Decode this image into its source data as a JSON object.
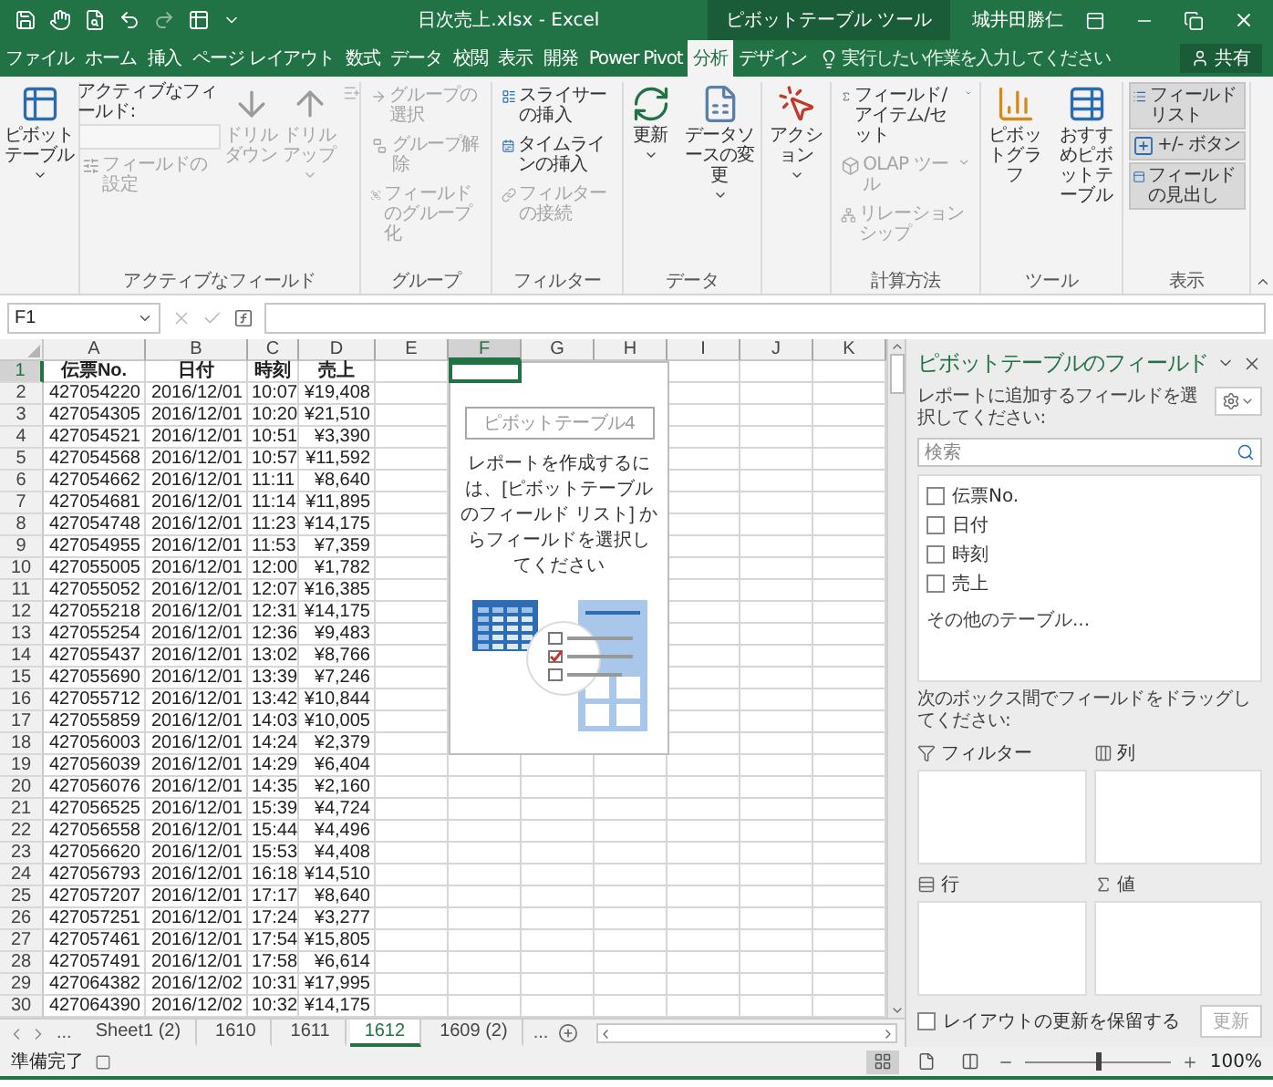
{
  "title_bar": {
    "title": "日次売上.xlsx - Excel",
    "context_tab": "ピボットテーブル ツール",
    "user": "城井田勝仁"
  },
  "tabs": [
    {
      "label": "ファイル",
      "selected": false
    },
    {
      "label": "ホーム",
      "selected": false
    },
    {
      "label": "挿入",
      "selected": false
    },
    {
      "label": "ページ レイアウト",
      "selected": false
    },
    {
      "label": "数式",
      "selected": false
    },
    {
      "label": "データ",
      "selected": false
    },
    {
      "label": "校閲",
      "selected": false
    },
    {
      "label": "表示",
      "selected": false
    },
    {
      "label": "開発",
      "selected": false
    },
    {
      "label": "Power Pivot",
      "selected": false
    },
    {
      "label": "分析",
      "selected": true
    },
    {
      "label": "デザイン",
      "selected": false
    }
  ],
  "tell_me": {
    "placeholder": "実行したい作業を入力してください"
  },
  "share": "共有",
  "ribbon": [
    {
      "items": [
        {
          "kind": "large",
          "label": "ピボットテーブル",
          "disabled": false
        }
      ]
    },
    {
      "label": "アクティブなフィールド",
      "items": [
        {
          "kind": "stack",
          "items": [
            {
              "kind": "field",
              "caption": "アクティブなフィールド:",
              "disabled": true
            },
            {
              "kind": "small",
              "label": "フィールドの設定",
              "disabled": true
            }
          ]
        },
        {
          "kind": "large",
          "label": "ドリルダウン",
          "disabled": true
        },
        {
          "kind": "large",
          "label": "ドリルアップ",
          "disabled": true
        },
        {
          "kind": "icon",
          "disabled": true
        }
      ]
    },
    {
      "label": "グループ",
      "items": [
        {
          "kind": "stack",
          "items": [
            {
              "kind": "small",
              "label": "グループの選択",
              "disabled": true
            },
            {
              "kind": "small",
              "label": "グループ解除",
              "disabled": true
            },
            {
              "kind": "small",
              "label": "フィールドのグループ化",
              "disabled": true
            }
          ]
        }
      ]
    },
    {
      "label": "フィルター",
      "items": [
        {
          "kind": "stack",
          "items": [
            {
              "kind": "small",
              "label": "スライサーの挿入",
              "disabled": false
            },
            {
              "kind": "small",
              "label": "タイムラインの挿入",
              "disabled": false
            },
            {
              "kind": "small",
              "label": "フィルターの接続",
              "disabled": true
            }
          ]
        }
      ]
    },
    {
      "label": "データ",
      "items": [
        {
          "kind": "large",
          "label": "更新",
          "disabled": false
        },
        {
          "kind": "large",
          "label": "データソースの変更",
          "disabled": false
        }
      ]
    },
    {
      "items": [
        {
          "kind": "large",
          "label": "アクション",
          "disabled": false
        }
      ]
    },
    {
      "label": "計算方法",
      "items": [
        {
          "kind": "stack",
          "items": [
            {
              "kind": "small",
              "label": "フィールド/アイテム/セット",
              "disabled": false
            },
            {
              "kind": "small",
              "label": "OLAP ツール",
              "disabled": true
            },
            {
              "kind": "small",
              "label": "リレーションシップ",
              "disabled": true
            }
          ]
        }
      ]
    },
    {
      "label": "ツール",
      "items": [
        {
          "kind": "large",
          "label": "ピボットグラフ",
          "disabled": false
        },
        {
          "kind": "large",
          "label": "おすすめピボットテーブル",
          "disabled": false
        }
      ]
    },
    {
      "label": "表示",
      "items": [
        {
          "kind": "stack",
          "items": [
            {
              "kind": "small",
              "label": "フィールドリスト",
              "on": true,
              "disabled": false
            },
            {
              "kind": "small",
              "label": "+/- ボタン",
              "on": true,
              "disabled": false
            },
            {
              "kind": "small",
              "label": "フィールドの見出し",
              "on": true,
              "disabled": false
            }
          ]
        }
      ]
    }
  ],
  "formula_bar": {
    "name_box": "F1"
  },
  "sheet": {
    "columns": [
      {
        "label": "A",
        "selected": false
      },
      {
        "label": "B",
        "selected": false
      },
      {
        "label": "C",
        "selected": false
      },
      {
        "label": "D",
        "selected": false
      },
      {
        "label": "E",
        "selected": false
      },
      {
        "label": "F",
        "selected": true
      },
      {
        "label": "G",
        "selected": false
      },
      {
        "label": "H",
        "selected": false
      },
      {
        "label": "I",
        "selected": false
      },
      {
        "label": "J",
        "selected": false
      },
      {
        "label": "K",
        "selected": false
      }
    ],
    "rows": [
      {
        "number": "1",
        "kind": "header",
        "selected": true,
        "cells": [
          "伝票No.",
          "日付",
          "時刻",
          "売上"
        ]
      },
      {
        "number": "2",
        "kind": "data",
        "selected": false,
        "cells": [
          "427054220",
          "2016/12/01",
          "10:07",
          "¥19,408"
        ]
      },
      {
        "number": "3",
        "kind": "data",
        "selected": false,
        "cells": [
          "427054305",
          "2016/12/01",
          "10:20",
          "¥21,510"
        ]
      },
      {
        "number": "4",
        "kind": "data",
        "selected": false,
        "cells": [
          "427054521",
          "2016/12/01",
          "10:51",
          "¥3,390"
        ]
      },
      {
        "number": "5",
        "kind": "data",
        "selected": false,
        "cells": [
          "427054568",
          "2016/12/01",
          "10:57",
          "¥11,592"
        ]
      },
      {
        "number": "6",
        "kind": "data",
        "selected": false,
        "cells": [
          "427054662",
          "2016/12/01",
          "11:11",
          "¥8,640"
        ]
      },
      {
        "number": "7",
        "kind": "data",
        "selected": false,
        "cells": [
          "427054681",
          "2016/12/01",
          "11:14",
          "¥11,895"
        ]
      },
      {
        "number": "8",
        "kind": "data",
        "selected": false,
        "cells": [
          "427054748",
          "2016/12/01",
          "11:23",
          "¥14,175"
        ]
      },
      {
        "number": "9",
        "kind": "data",
        "selected": false,
        "cells": [
          "427054955",
          "2016/12/01",
          "11:53",
          "¥7,359"
        ]
      },
      {
        "number": "10",
        "kind": "data",
        "selected": false,
        "cells": [
          "427055005",
          "2016/12/01",
          "12:00",
          "¥1,782"
        ]
      },
      {
        "number": "11",
        "kind": "data",
        "selected": false,
        "cells": [
          "427055052",
          "2016/12/01",
          "12:07",
          "¥16,385"
        ]
      },
      {
        "number": "12",
        "kind": "data",
        "selected": false,
        "cells": [
          "427055218",
          "2016/12/01",
          "12:31",
          "¥14,175"
        ]
      },
      {
        "number": "13",
        "kind": "data",
        "selected": false,
        "cells": [
          "427055254",
          "2016/12/01",
          "12:36",
          "¥9,483"
        ]
      },
      {
        "number": "14",
        "kind": "data",
        "selected": false,
        "cells": [
          "427055437",
          "2016/12/01",
          "13:02",
          "¥8,766"
        ]
      },
      {
        "number": "15",
        "kind": "data",
        "selected": false,
        "cells": [
          "427055690",
          "2016/12/01",
          "13:39",
          "¥7,246"
        ]
      },
      {
        "number": "16",
        "kind": "data",
        "selected": false,
        "cells": [
          "427055712",
          "2016/12/01",
          "13:42",
          "¥10,844"
        ]
      },
      {
        "number": "17",
        "kind": "data",
        "selected": false,
        "cells": [
          "427055859",
          "2016/12/01",
          "14:03",
          "¥10,005"
        ]
      },
      {
        "number": "18",
        "kind": "data",
        "selected": false,
        "cells": [
          "427056003",
          "2016/12/01",
          "14:24",
          "¥2,379"
        ]
      },
      {
        "number": "19",
        "kind": "data",
        "selected": false,
        "cells": [
          "427056039",
          "2016/12/01",
          "14:29",
          "¥6,404"
        ]
      },
      {
        "number": "20",
        "kind": "data",
        "selected": false,
        "cells": [
          "427056076",
          "2016/12/01",
          "14:35",
          "¥2,160"
        ]
      },
      {
        "number": "21",
        "kind": "data",
        "selected": false,
        "cells": [
          "427056525",
          "2016/12/01",
          "15:39",
          "¥4,724"
        ]
      },
      {
        "number": "22",
        "kind": "data",
        "selected": false,
        "cells": [
          "427056558",
          "2016/12/01",
          "15:44",
          "¥4,496"
        ]
      },
      {
        "number": "23",
        "kind": "data",
        "selected": false,
        "cells": [
          "427056620",
          "2016/12/01",
          "15:53",
          "¥4,408"
        ]
      },
      {
        "number": "24",
        "kind": "data",
        "selected": false,
        "cells": [
          "427056793",
          "2016/12/01",
          "16:18",
          "¥14,510"
        ]
      },
      {
        "number": "25",
        "kind": "data",
        "selected": false,
        "cells": [
          "427057207",
          "2016/12/01",
          "17:17",
          "¥8,640"
        ]
      },
      {
        "number": "26",
        "kind": "data",
        "selected": false,
        "cells": [
          "427057251",
          "2016/12/01",
          "17:24",
          "¥3,277"
        ]
      },
      {
        "number": "27",
        "kind": "data",
        "selected": false,
        "cells": [
          "427057461",
          "2016/12/01",
          "17:54",
          "¥15,805"
        ]
      },
      {
        "number": "28",
        "kind": "data",
        "selected": false,
        "cells": [
          "427057491",
          "2016/12/01",
          "17:58",
          "¥6,614"
        ]
      },
      {
        "number": "29",
        "kind": "data",
        "selected": false,
        "cells": [
          "427064382",
          "2016/12/02",
          "10:31",
          "¥17,995"
        ]
      },
      {
        "number": "30",
        "kind": "data",
        "selected": false,
        "cells": [
          "427064390",
          "2016/12/02",
          "10:32",
          "¥14,175"
        ]
      }
    ]
  },
  "pivot_placeholder": {
    "name": "ピボットテーブル4",
    "message": "レポートを作成するには、[ピボットテーブルのフィールド リスト] からフィールドを選択してください"
  },
  "sheet_tabs": {
    "more_left": "...",
    "tabs": [
      {
        "label": "Sheet1 (2)",
        "selected": false
      },
      {
        "label": "1610",
        "selected": false
      },
      {
        "label": "1611",
        "selected": false
      },
      {
        "label": "1612",
        "selected": true
      },
      {
        "label": "1609 (2)",
        "selected": false
      }
    ],
    "more_right": "..."
  },
  "pivot_panel": {
    "title": "ピボットテーブルのフィールド",
    "subtitle": "レポートに追加するフィールドを選択してください:",
    "search": {
      "placeholder": "検索"
    },
    "fields": [
      {
        "label": "伝票No.",
        "checked": false
      },
      {
        "label": "日付",
        "checked": false
      },
      {
        "label": "時刻",
        "checked": false
      },
      {
        "label": "売上",
        "checked": false
      }
    ],
    "more_tables": "その他のテーブル...",
    "drag_hint": "次のボックス間でフィールドをドラッグしてください:",
    "areas": [
      {
        "kind": "filter",
        "label": "フィルター"
      },
      {
        "kind": "columns",
        "label": "列"
      },
      {
        "kind": "rows",
        "label": "行"
      },
      {
        "kind": "values",
        "label": "値"
      }
    ],
    "defer": {
      "label": "レイアウトの更新を保留する",
      "checked": false
    },
    "update": {
      "label": "更新",
      "disabled": true
    }
  },
  "status_bar": {
    "text": "準備完了",
    "views": [
      {
        "selected": true
      },
      {
        "selected": false
      },
      {
        "selected": false
      }
    ],
    "zoom": {
      "level": 0.5,
      "reading": "100%"
    }
  }
}
